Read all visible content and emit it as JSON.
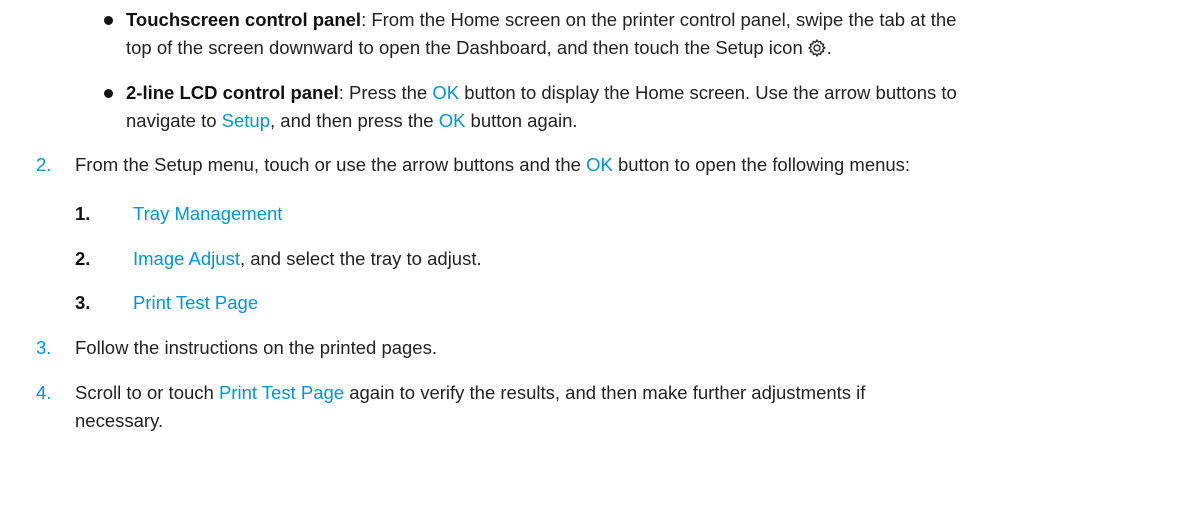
{
  "bullets": [
    {
      "title": "Touchscreen control panel",
      "sep": ": ",
      "line1": "From the Home screen on the printer control panel, swipe the tab at the",
      "line2": "top of the screen downward to open the Dashboard, and then touch the Setup icon",
      "tail": ".",
      "icon": "gear-icon"
    },
    {
      "title": "2-line LCD control panel",
      "t1": ": Press the ",
      "k1": "OK",
      "t2": " button to display the Home screen. Use the arrow buttons to",
      "t3": "navigate to ",
      "k2": "Setup",
      "t4": ", and then press the ",
      "k3": "OK",
      "t5": " button again."
    }
  ],
  "steps": [
    {
      "num": "2.",
      "pre": "From the Setup menu, touch or use the arrow buttons and the ",
      "key": "OK",
      "post": " button to open the following menus:",
      "substeps": [
        {
          "num": "1.",
          "link": "Tray Management",
          "post": ""
        },
        {
          "num": "2.",
          "link": "Image Adjust",
          "post": ", and select the tray to adjust."
        },
        {
          "num": "3.",
          "link": "Print Test Page",
          "post": ""
        }
      ]
    },
    {
      "num": "3.",
      "text": "Follow the instructions on the printed pages."
    },
    {
      "num": "4.",
      "pre": "Scroll to or touch ",
      "link": "Print Test Page",
      "post": " again to verify the results, and then make further adjustments if",
      "line2": "necessary."
    }
  ],
  "colors": {
    "link": "#0096d6",
    "text": "#222222",
    "emphasis": "#111111"
  }
}
